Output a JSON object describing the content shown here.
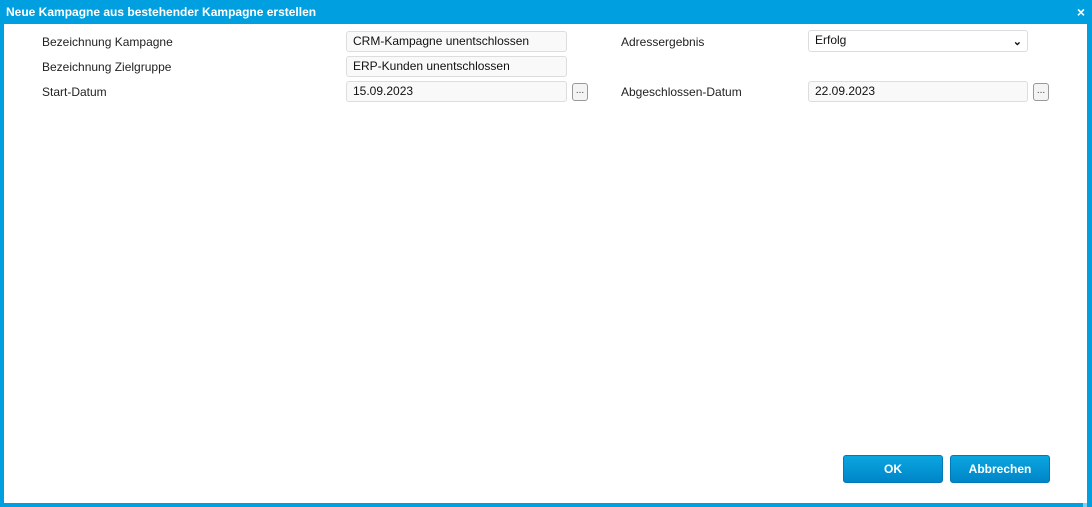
{
  "dialog": {
    "title": "Neue Kampagne aus bestehender Kampagne erstellen",
    "close_icon": "×"
  },
  "form": {
    "campaign_name": {
      "label": "Bezeichnung Kampagne",
      "value": "CRM-Kampagne unentschlossen"
    },
    "target_group": {
      "label": "Bezeichnung Zielgruppe",
      "value": "ERP-Kunden unentschlossen"
    },
    "start_date": {
      "label": "Start-Datum",
      "value": "15.09.2023",
      "picker": "..."
    },
    "address_result": {
      "label": "Adressergebnis",
      "value": "Erfolg"
    },
    "end_date": {
      "label": "Abgeschlossen-Datum",
      "value": "22.09.2023",
      "picker": "..."
    }
  },
  "buttons": {
    "ok": "OK",
    "cancel": "Abbrechen"
  }
}
